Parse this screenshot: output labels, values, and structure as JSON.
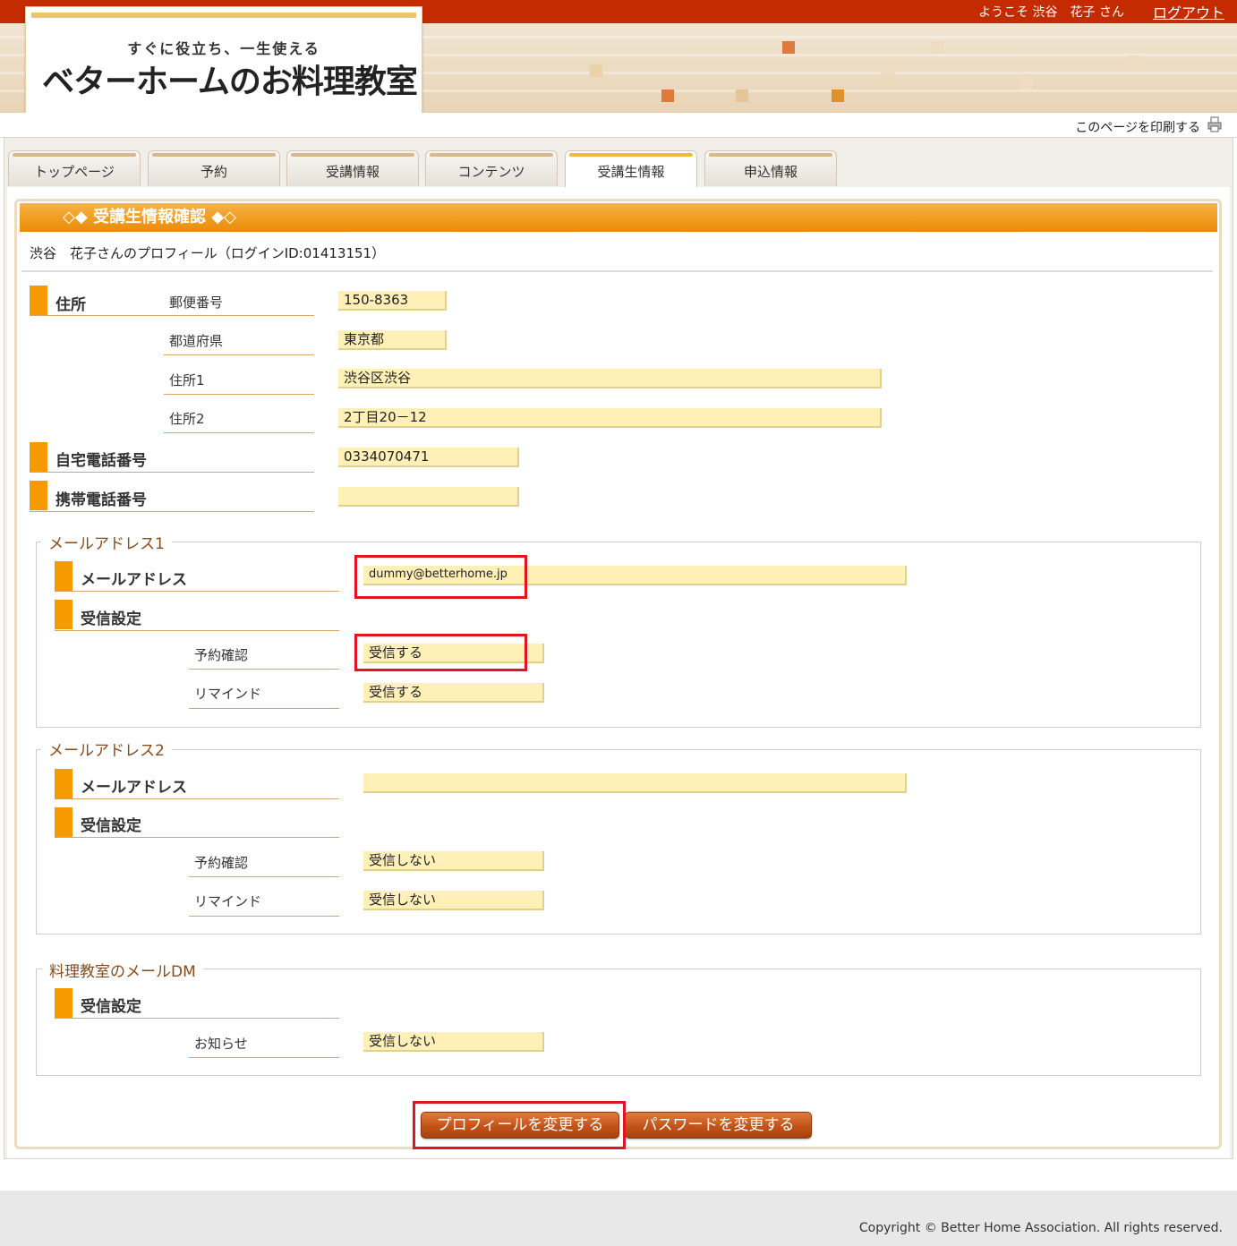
{
  "header": {
    "welcome": "ようこそ 渋谷　花子 さん",
    "logout": "ログアウト",
    "logo_tagline": "すぐに役立ち、一生使える",
    "logo_name": "ベターホームのお料理教室",
    "print_link": "このページを印刷する"
  },
  "tabs": [
    {
      "label": "トップページ"
    },
    {
      "label": "予約"
    },
    {
      "label": "受講情報"
    },
    {
      "label": "コンテンツ"
    },
    {
      "label": "受講生情報",
      "active": true
    },
    {
      "label": "申込情報"
    }
  ],
  "page": {
    "title": "◇◆ 受講生情報確認 ◆◇",
    "profile_title": "渋谷　花子さんのプロフィール（ログインID:01413151）"
  },
  "address": {
    "label": "住所",
    "postal_label": "郵便番号",
    "postal_value": "150-8363",
    "pref_label": "都道府県",
    "pref_value": "東京都",
    "addr1_label": "住所1",
    "addr1_value": "渋谷区渋谷",
    "addr2_label": "住所2",
    "addr2_value": "2丁目20－12"
  },
  "home_phone": {
    "label": "自宅電話番号",
    "value": "0334070471"
  },
  "mobile_phone": {
    "label": "携帯電話番号",
    "value": ""
  },
  "mail1": {
    "legend": "メールアドレス1",
    "address_label": "メールアドレス",
    "address_value": "dummy@betterhome.jp",
    "receive_label": "受信設定",
    "reservation_label": "予約確認",
    "reservation_value": "受信する",
    "remind_label": "リマインド",
    "remind_value": "受信する"
  },
  "mail2": {
    "legend": "メールアドレス2",
    "address_label": "メールアドレス",
    "address_value": "",
    "receive_label": "受信設定",
    "reservation_label": "予約確認",
    "reservation_value": "受信しない",
    "remind_label": "リマインド",
    "remind_value": "受信しない"
  },
  "dm": {
    "legend": "料理教室のメールDM",
    "receive_label": "受信設定",
    "notice_label": "お知らせ",
    "notice_value": "受信しない"
  },
  "buttons": {
    "change_profile": "プロフィールを変更する",
    "change_password": "パスワードを変更する"
  },
  "footer": {
    "copyright": "Copyright © Better Home Association. All rights reserved."
  },
  "colors": {
    "topbar": "#c42b00",
    "accent": "#f59a00",
    "field": "#fff0b8",
    "highlight": "#e0151f"
  }
}
